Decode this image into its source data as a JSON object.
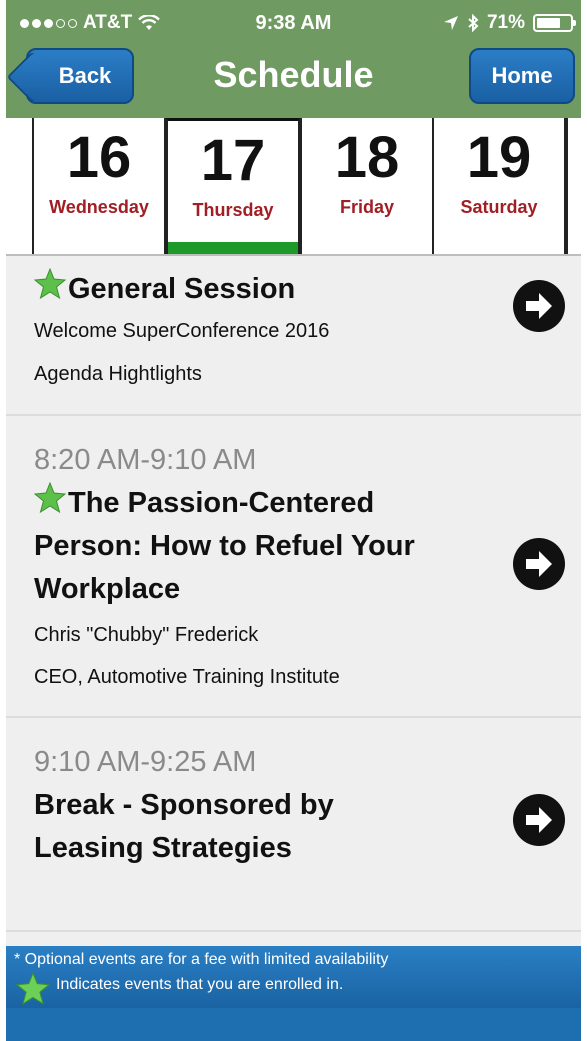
{
  "status_bar": {
    "carrier": "AT&T",
    "time": "9:38 AM",
    "battery": "71%",
    "battery_level": 0.71
  },
  "nav": {
    "back_label": "Back",
    "title": "Schedule",
    "home_label": "Home"
  },
  "dates": [
    {
      "num": "16",
      "day": "Wednesday"
    },
    {
      "num": "17",
      "day": "Thursday",
      "selected": true
    },
    {
      "num": "18",
      "day": "Friday"
    },
    {
      "num": "19",
      "day": "Saturday"
    }
  ],
  "sessions": [
    {
      "title": "General Session",
      "starred": true,
      "lines": [
        "Welcome SuperConference 2016",
        "Agenda Hightlights"
      ]
    },
    {
      "time": "8:20 AM-9:10 AM",
      "title_lines": [
        "The Passion-Centered",
        "Person: How to Refuel Your",
        "Workplace"
      ],
      "starred": true,
      "lines": [
        "Chris \"Chubby\" Frederick",
        "CEO, Automotive Training Institute"
      ]
    },
    {
      "time": "9:10 AM-9:25 AM",
      "title_lines": [
        "Break - Sponsored by",
        "Leasing Strategies"
      ],
      "starred": false
    }
  ],
  "footer": {
    "note1": "* Optional events are for a fee with limited availability",
    "note2": "Indicates events that you are enrolled in."
  },
  "colors": {
    "nav_green": "#6f9a62",
    "button_blue": "#1a5fa3",
    "day_red": "#a11f24",
    "selected_green": "#1d9a2a",
    "footer_blue": "#1e6fb0"
  }
}
